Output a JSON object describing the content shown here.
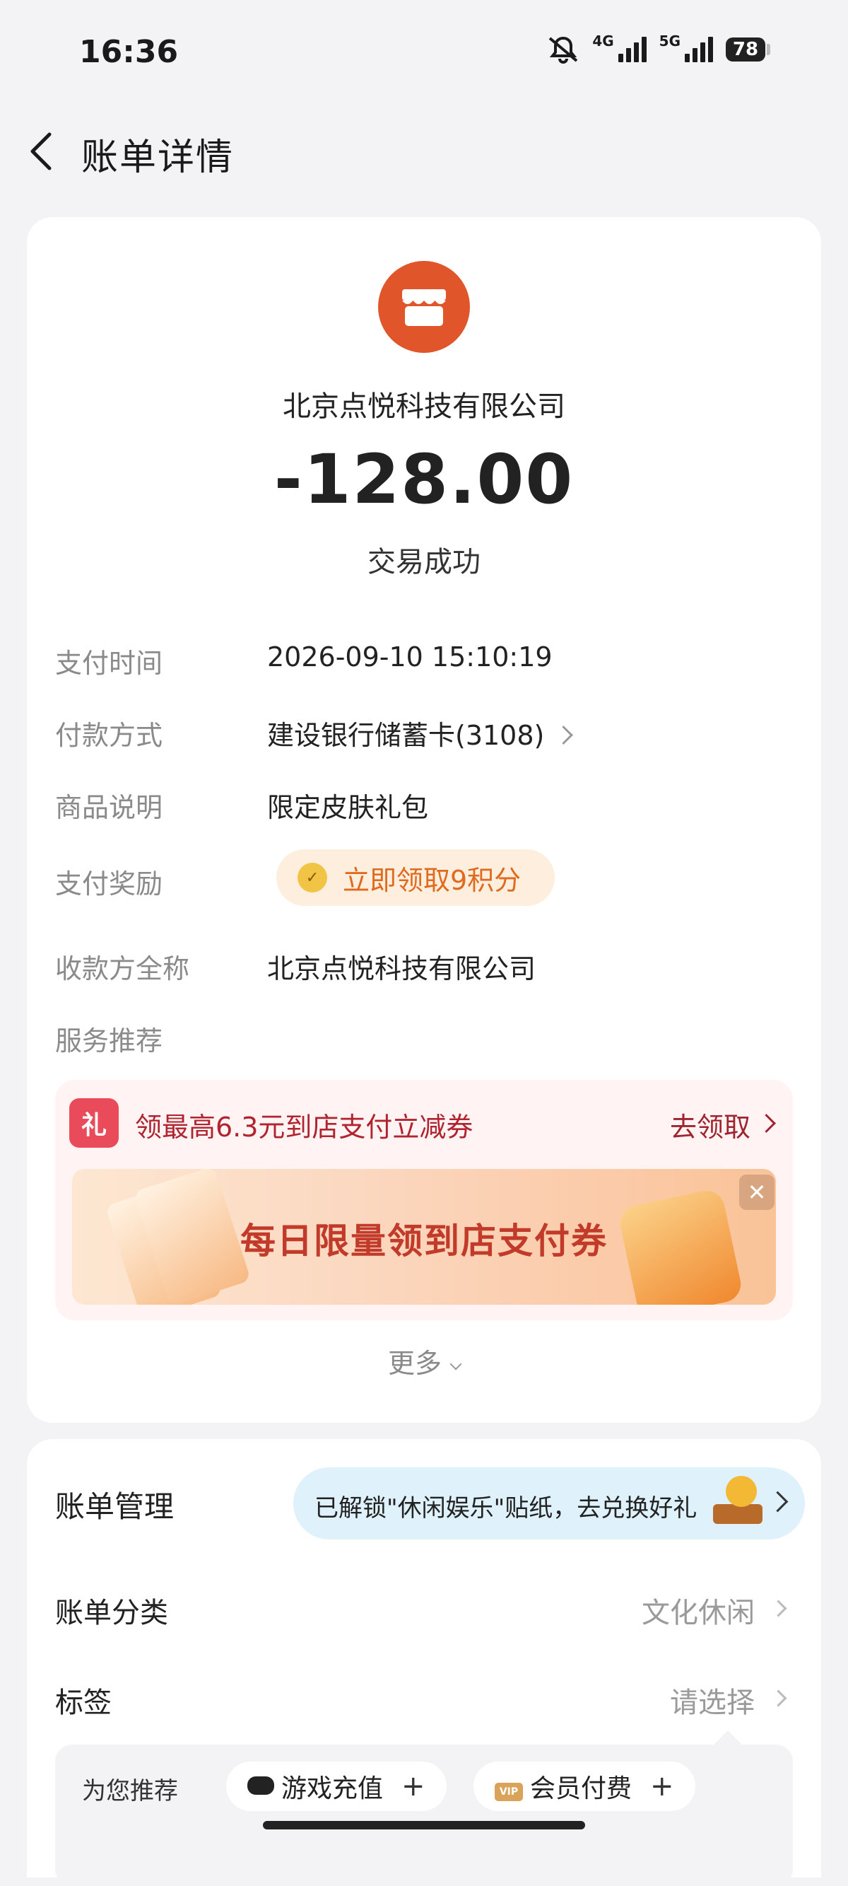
{
  "status_bar": {
    "time": "16:36",
    "net1": "4G",
    "net2": "5G",
    "battery": "78"
  },
  "header": {
    "title": "账单详情"
  },
  "transaction": {
    "merchant": "北京点悦科技有限公司",
    "amount": "-128.00",
    "status": "交易成功"
  },
  "details": {
    "pay_time_label": "支付时间",
    "pay_time": "2026-09-10 15:10:19",
    "pay_method_label": "付款方式",
    "pay_method": "建设银行储蓄卡(3108)",
    "product_label": "商品说明",
    "product": "限定皮肤礼包",
    "reward_label": "支付奖励",
    "reward": "立即领取9积分",
    "payee_label": "收款方全称",
    "payee": "北京点悦科技有限公司",
    "service_label": "服务推荐"
  },
  "promo": {
    "gift_char": "礼",
    "title": "领最高6.3元到店支付立减券",
    "link": "去领取",
    "banner_text": "每日限量领到店支付券"
  },
  "more_label": "更多",
  "management": {
    "title": "账单管理",
    "sticker_text": "已解锁\"休闲娱乐\"贴纸，去兑换好礼",
    "category_label": "账单分类",
    "category_value": "文化休闲",
    "tag_label": "标签",
    "tag_value": "请选择",
    "recommend_label": "为您推荐",
    "chips": [
      "游戏充值",
      "会员付费"
    ],
    "vip_badge": "VIP"
  },
  "colors": {
    "accent": "#e0562a",
    "reward": "#e06b1e",
    "promo_red": "#b0242f"
  }
}
